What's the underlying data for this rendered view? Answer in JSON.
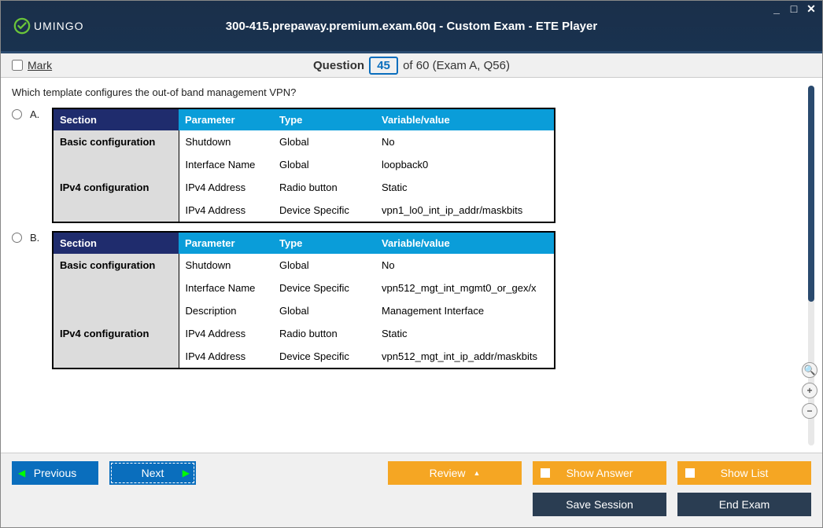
{
  "window": {
    "title": "300-415.prepaway.premium.exam.60q - Custom Exam - ETE Player",
    "logo_text": "UMINGO"
  },
  "subbar": {
    "mark_label": "Mark",
    "question_word": "Question",
    "current": "45",
    "of": "of 60 (Exam A, Q56)"
  },
  "question_text": "Which template configures the out-of band management VPN?",
  "headers": {
    "section": "Section",
    "parameter": "Parameter",
    "type": "Type",
    "varval": "Variable/value"
  },
  "options": {
    "A": {
      "label": "A.",
      "sections": {
        "basic": "Basic configuration",
        "ipv4": "IPv4 configuration"
      },
      "rows": {
        "r1": {
          "p": "Shutdown",
          "t": "Global",
          "v": "No"
        },
        "r2": {
          "p": "Interface Name",
          "t": "Global",
          "v": "loopback0"
        },
        "r3": {
          "p": "IPv4 Address",
          "t": "Radio button",
          "v": "Static"
        },
        "r4": {
          "p": "IPv4 Address",
          "t": "Device Specific",
          "v": "vpn1_lo0_int_ip_addr/maskbits"
        }
      }
    },
    "B": {
      "label": "B.",
      "sections": {
        "basic": "Basic configuration",
        "ipv4": "IPv4 configuration"
      },
      "rows": {
        "r1": {
          "p": "Shutdown",
          "t": "Global",
          "v": "No"
        },
        "r2": {
          "p": "Interface Name",
          "t": "Device Specific",
          "v": "vpn512_mgt_int_mgmt0_or_gex/x"
        },
        "r3": {
          "p": "Description",
          "t": "Global",
          "v": "Management Interface"
        },
        "r4": {
          "p": "IPv4 Address",
          "t": "Radio button",
          "v": "Static"
        },
        "r5": {
          "p": "IPv4 Address",
          "t": "Device Specific",
          "v": "vpn512_mgt_int_ip_addr/maskbits"
        }
      }
    }
  },
  "footer": {
    "previous": "Previous",
    "next": "Next",
    "review": "Review",
    "show_answer": "Show Answer",
    "show_list": "Show List",
    "save_session": "Save Session",
    "end_exam": "End Exam"
  }
}
